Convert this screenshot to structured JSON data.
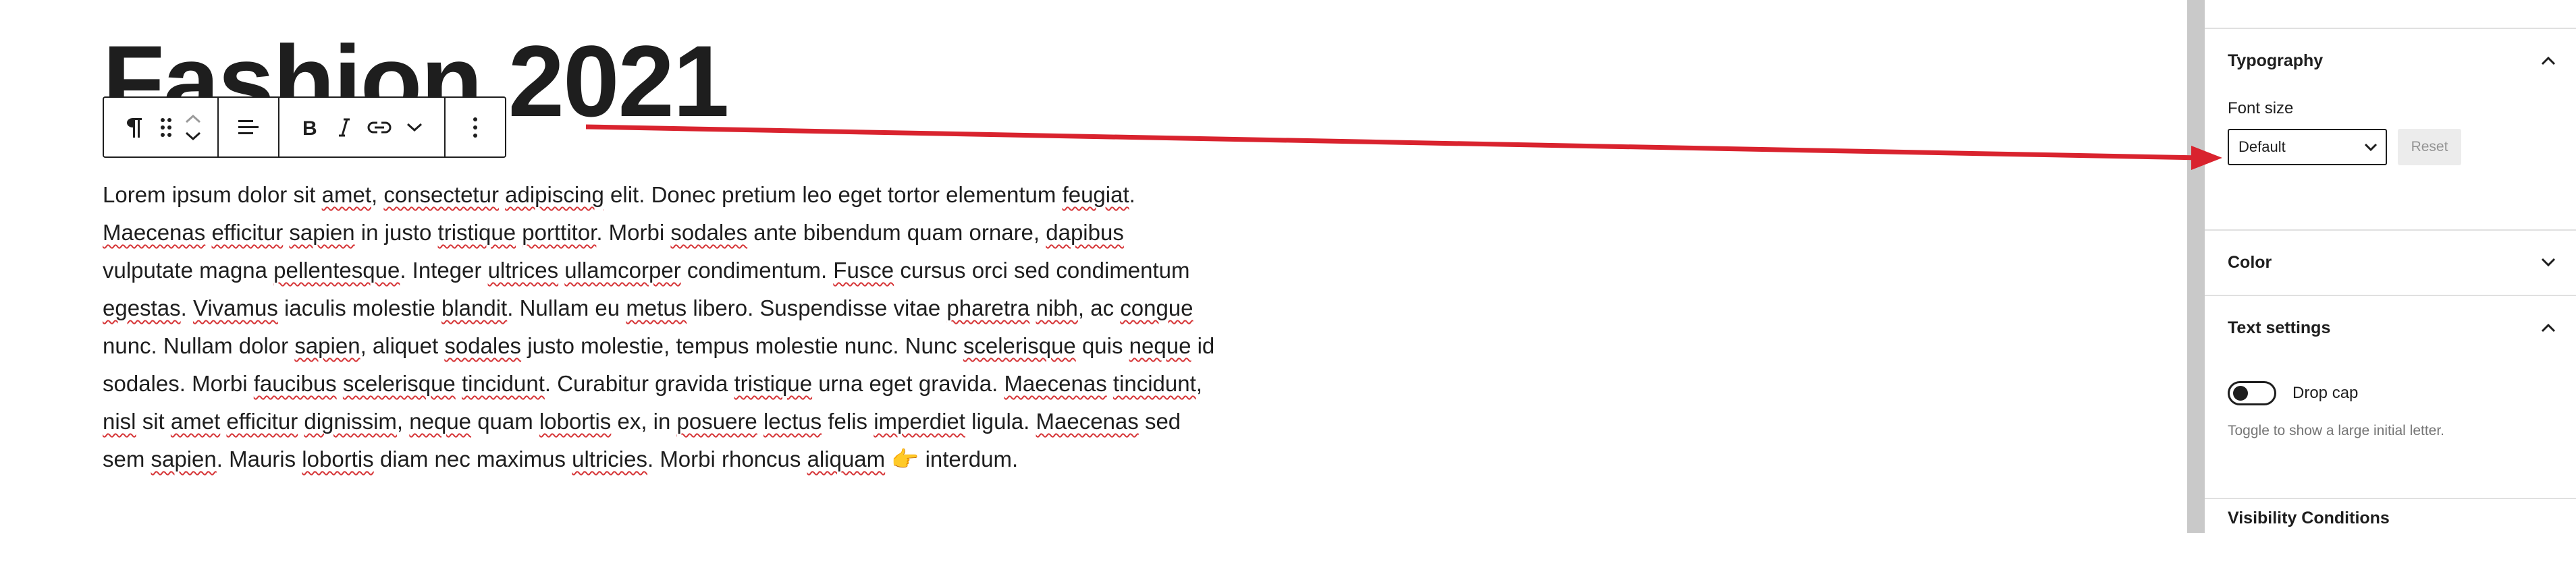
{
  "editor": {
    "title": "Fashion 2021",
    "paragraph_runs": [
      {
        "t": "Lorem ipsum dolor sit "
      },
      {
        "t": "amet",
        "s": 1
      },
      {
        "t": ", "
      },
      {
        "t": "consectetur",
        "s": 1
      },
      {
        "t": " "
      },
      {
        "t": "adipiscing",
        "s": 1
      },
      {
        "t": " elit. Donec pretium leo eget tortor elementum "
      },
      {
        "t": "feugiat",
        "s": 1
      },
      {
        "t": ". "
      },
      {
        "t": "Maecenas",
        "s": 1
      },
      {
        "t": " "
      },
      {
        "t": "efficitur",
        "s": 1
      },
      {
        "t": " "
      },
      {
        "t": "sapien",
        "s": 1
      },
      {
        "t": " in justo "
      },
      {
        "t": "tristique",
        "s": 1
      },
      {
        "t": " "
      },
      {
        "t": "porttitor",
        "s": 1
      },
      {
        "t": ". Morbi "
      },
      {
        "t": "sodales",
        "s": 1
      },
      {
        "t": " ante bibendum quam ornare, "
      },
      {
        "t": "dapibus",
        "s": 1
      },
      {
        "t": " "
      },
      {
        "t": "vulputate magna "
      },
      {
        "t": "pellentesque",
        "s": 1
      },
      {
        "t": ". Integer "
      },
      {
        "t": "ultrices",
        "s": 1
      },
      {
        "t": " "
      },
      {
        "t": "ullamcorper",
        "s": 1
      },
      {
        "t": " condimentum. "
      },
      {
        "t": "Fusce",
        "s": 1
      },
      {
        "t": " cursus orci sed "
      },
      {
        "t": "condimentum "
      },
      {
        "t": "egestas",
        "s": 1
      },
      {
        "t": ". "
      },
      {
        "t": "Vivamus",
        "s": 1
      },
      {
        "t": " iaculis molestie "
      },
      {
        "t": "blandit",
        "s": 1
      },
      {
        "t": ". Nullam eu "
      },
      {
        "t": "metus",
        "s": 1
      },
      {
        "t": " libero. Suspendisse vitae "
      },
      {
        "t": "pharetra",
        "s": 1
      },
      {
        "t": " "
      },
      {
        "t": "nibh",
        "s": 1
      },
      {
        "t": ", ac "
      },
      {
        "t": "congue",
        "s": 1
      },
      {
        "t": " nunc. Nullam dolor "
      },
      {
        "t": "sapien",
        "s": 1
      },
      {
        "t": ", aliquet "
      },
      {
        "t": "sodales",
        "s": 1
      },
      {
        "t": " justo molestie, tempus molestie nunc. Nunc "
      },
      {
        "t": "scelerisque",
        "s": 1
      },
      {
        "t": " quis "
      },
      {
        "t": "neque",
        "s": 1
      },
      {
        "t": " id sodales. Morbi "
      },
      {
        "t": "faucibus",
        "s": 1
      },
      {
        "t": " "
      },
      {
        "t": "scelerisque",
        "s": 1
      },
      {
        "t": " "
      },
      {
        "t": "tincidunt",
        "s": 1
      },
      {
        "t": ". Curabitur gravida "
      },
      {
        "t": "tristique",
        "s": 1
      },
      {
        "t": " urna eget "
      },
      {
        "t": "gravida. "
      },
      {
        "t": "Maecenas",
        "s": 1
      },
      {
        "t": " "
      },
      {
        "t": "tincidunt",
        "s": 1
      },
      {
        "t": ", "
      },
      {
        "t": "nisl",
        "s": 1
      },
      {
        "t": " sit "
      },
      {
        "t": "amet",
        "s": 1
      },
      {
        "t": " "
      },
      {
        "t": "efficitur",
        "s": 1
      },
      {
        "t": " "
      },
      {
        "t": "dignissim",
        "s": 1
      },
      {
        "t": ", "
      },
      {
        "t": "neque",
        "s": 1
      },
      {
        "t": " quam "
      },
      {
        "t": "lobortis",
        "s": 1
      },
      {
        "t": " ex, in "
      },
      {
        "t": "posuere",
        "s": 1
      },
      {
        "t": " "
      },
      {
        "t": "lectus",
        "s": 1
      },
      {
        "t": " felis "
      },
      {
        "t": "imperdiet",
        "s": 1
      },
      {
        "t": " ligula. "
      },
      {
        "t": "Maecenas",
        "s": 1
      },
      {
        "t": " sed sem "
      },
      {
        "t": "sapien",
        "s": 1
      },
      {
        "t": ". Mauris "
      },
      {
        "t": "lobortis",
        "s": 1
      },
      {
        "t": " diam nec maximus "
      },
      {
        "t": "ultricies",
        "s": 1
      },
      {
        "t": ". Morbi rhoncus "
      },
      {
        "t": "aliquam",
        "s": 1
      },
      {
        "t": " 👉 interdum."
      }
    ]
  },
  "toolbar": {
    "icons": [
      "paragraph-icon",
      "drag-handle-icon",
      "move-up-icon",
      "move-down-icon",
      "align-icon",
      "bold-icon",
      "italic-icon",
      "link-icon",
      "more-rich-text-icon",
      "options-icon"
    ]
  },
  "sidebar": {
    "typography": {
      "title": "Typography",
      "font_size_label": "Font size",
      "font_size_value": "Default",
      "reset_label": "Reset"
    },
    "color": {
      "title": "Color"
    },
    "text_settings": {
      "title": "Text settings",
      "drop_cap_label": "Drop cap",
      "drop_cap_help": "Toggle to show a large initial letter.",
      "drop_cap_enabled": false
    },
    "visibility": {
      "title": "Visibility Conditions"
    }
  },
  "colors": {
    "arrow": "#d9232e",
    "text": "#1e1e1e",
    "spell_underline": "#d63638",
    "reset_bg": "#ececec",
    "help_text": "#757575"
  }
}
